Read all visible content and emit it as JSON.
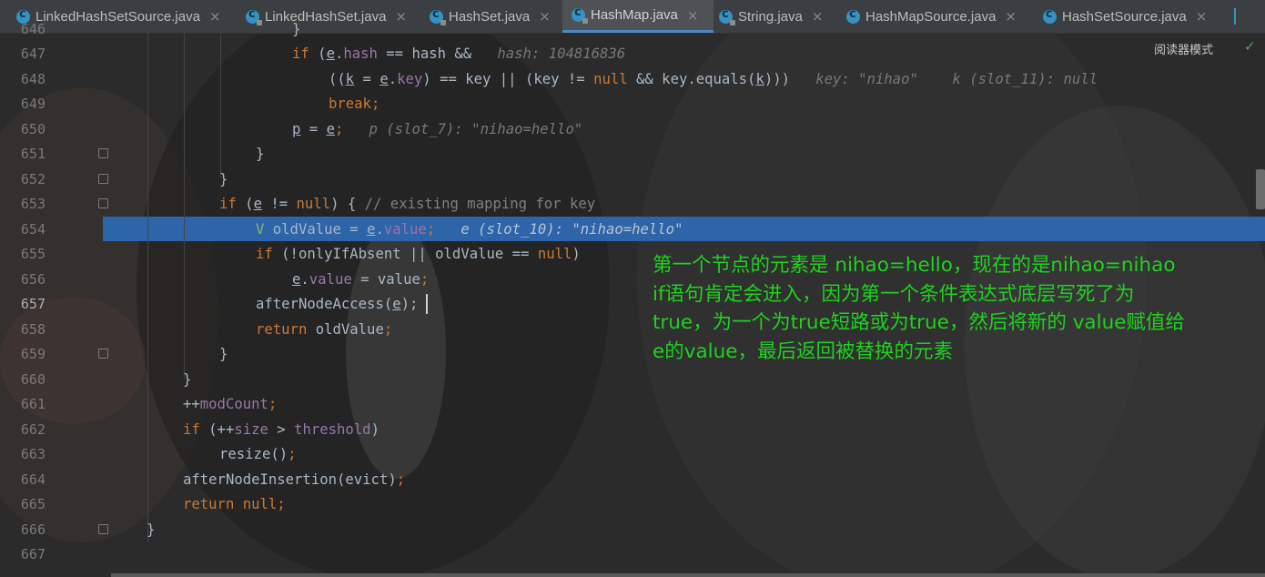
{
  "tabs": [
    {
      "label": "LinkedHashSetSource.java",
      "active": false,
      "locked": false
    },
    {
      "label": "LinkedHashSet.java",
      "active": false,
      "locked": true
    },
    {
      "label": "HashSet.java",
      "active": false,
      "locked": true
    },
    {
      "label": "HashMap.java",
      "active": true,
      "locked": true
    },
    {
      "label": "String.java",
      "active": false,
      "locked": true
    },
    {
      "label": "HashMapSource.java",
      "active": false,
      "locked": false
    },
    {
      "label": "HashSetSource.java",
      "active": false,
      "locked": false
    }
  ],
  "tab_close_glyph": "×",
  "reader_mode_label": "阅读器模式",
  "check_icon": "✓",
  "line_numbers": {
    "partial_top": "646",
    "n647": "647",
    "n648": "648",
    "n649": "649",
    "n650": "650",
    "n651": "651",
    "n652": "652",
    "n653": "653",
    "n654": "654",
    "n655": "655",
    "n656": "656",
    "n657": "657",
    "n658": "658",
    "n659": "659",
    "n660": "660",
    "n661": "661",
    "n662": "662",
    "n663": "663",
    "n664": "664",
    "n665": "665",
    "n666": "666",
    "n667": "667"
  },
  "current_line": "657",
  "highlighted_line": "654",
  "code": {
    "l646": "}",
    "l647_kw": "if",
    "l647_a": " (",
    "l647_e": "e",
    "l647_b": ".",
    "l647_f": "hash",
    "l647_c": " == hash &&",
    "l647_hint": "hash: 104816836",
    "l648_a": "((",
    "l648_k": "k",
    "l648_b": " = ",
    "l648_e": "e",
    "l648_c": ".",
    "l648_f": "key",
    "l648_d": ") == key || (key != ",
    "l648_null": "null",
    "l648_g": " && key.equals(",
    "l648_k2": "k",
    "l648_h": ")))",
    "l648_hint1": "key: \"nihao\"",
    "l648_hint2": "k (slot_11): null",
    "l649": "break;",
    "l650_p": "p",
    "l650_a": " = ",
    "l650_e": "e",
    "l650_b": ";",
    "l650_hint": "p (slot_7): \"nihao=hello\"",
    "l651": "}",
    "l652": "}",
    "l653_kw": "if",
    "l653_a": " (",
    "l653_e": "e",
    "l653_b": " != ",
    "l653_null": "null",
    "l653_c": ") { ",
    "l653_cm": "// existing mapping for key",
    "l654_v": "V",
    "l654_a": " oldValue = ",
    "l654_e": "e",
    "l654_b": ".",
    "l654_f": "value",
    "l654_c": ";",
    "l654_hint": "e (slot_10): \"nihao=hello\"",
    "l655_kw": "if",
    "l655_a": " (!onlyIfAbsent || oldValue == ",
    "l655_null": "null",
    "l655_b": ")",
    "l656_e": "e",
    "l656_a": ".",
    "l656_f": "value",
    "l656_b": " = value",
    "l656_c": ";",
    "l657_a": "afterNodeAccess(",
    "l657_e": "e",
    "l657_b": ");",
    "l658_kw": "return",
    "l658_a": " oldValue",
    "l658_b": ";",
    "l659": "}",
    "l660": "}",
    "l661_a": "++",
    "l661_f": "modCount",
    "l661_b": ";",
    "l662_kw": "if",
    "l662_a": " (++",
    "l662_f": "size",
    "l662_b": " > ",
    "l662_g": "threshold",
    "l662_c": ")",
    "l663_a": "resize()",
    "l663_b": ";",
    "l664_a": "afterNodeInsertion(evict)",
    "l664_b": ";",
    "l665_kw": "return",
    "l665_sp": " ",
    "l665_null": "null",
    "l665_b": ";",
    "l666": "}"
  },
  "annotation": {
    "line1": "第一个节点的元素是 nihao=hello，现在的是nihao=nihao",
    "line2": "if语句肯定会进入，因为第一个条件表达式底层写死了为",
    "line3": "true，为一个为true短路或为true，然后将新的 value赋值给",
    "line4": "e的value，最后返回被替换的元素",
    "color": "#1fd21f"
  },
  "colors": {
    "editor_bg": "#2b2b2b",
    "keyword": "#cc7832",
    "field": "#9876aa",
    "text": "#a9b7c6",
    "highlight": "#2d65a8"
  }
}
